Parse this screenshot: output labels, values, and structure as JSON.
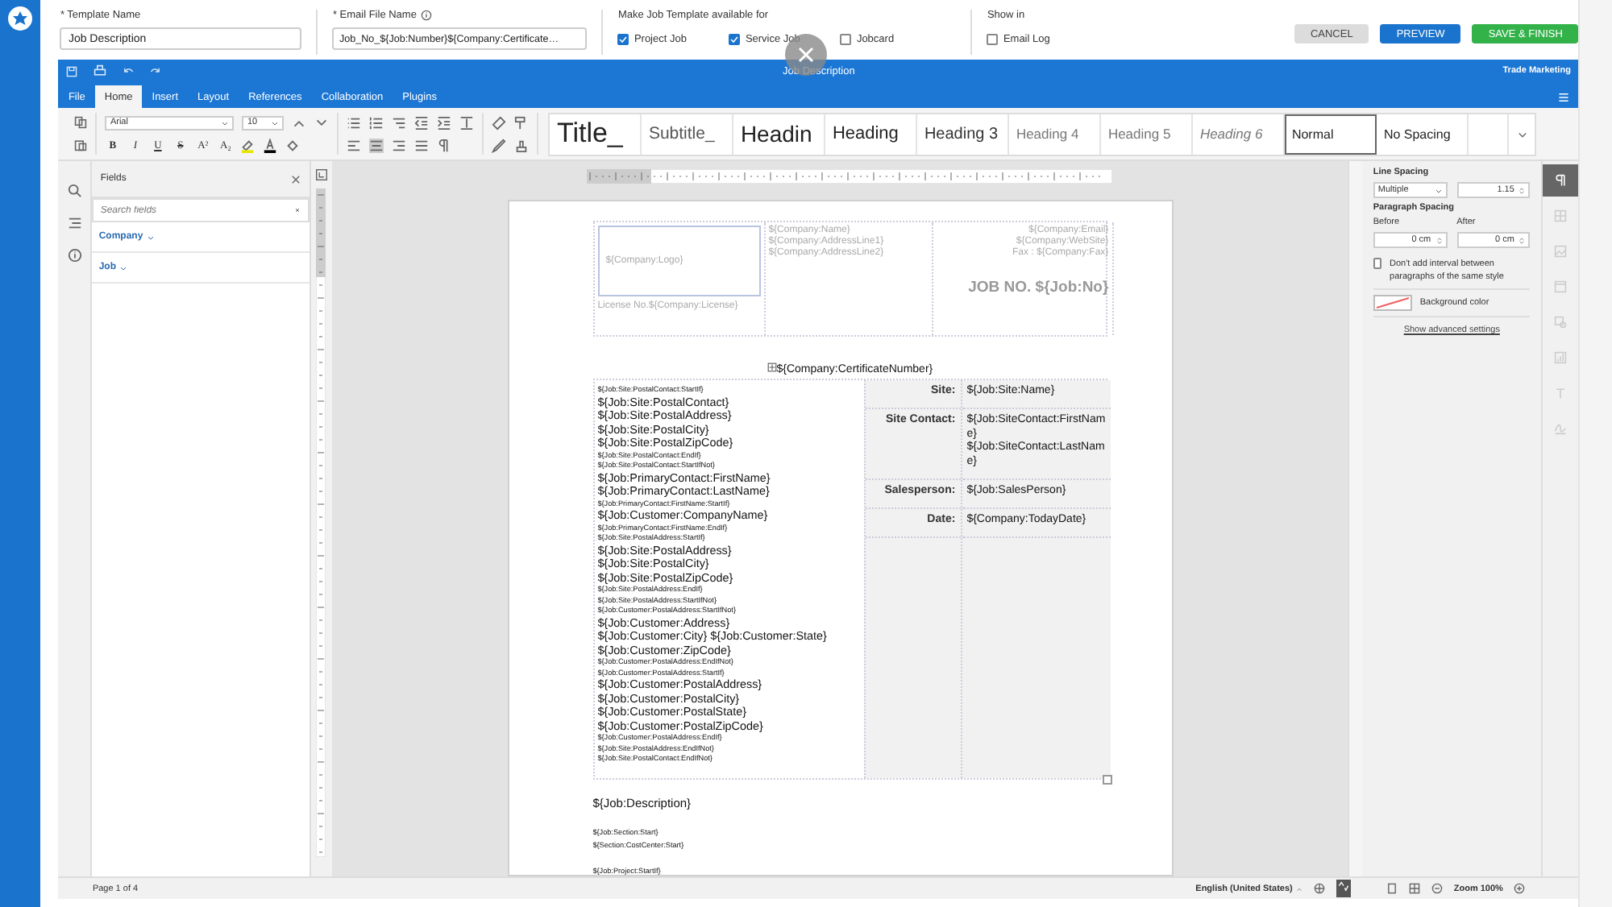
{
  "header": {
    "template_name": {
      "label": "* Template Name",
      "value": "Job Description"
    },
    "email_file_name": {
      "label": "* Email File Name",
      "value": "Job_No_${Job:Number}${Company:Certificate…"
    },
    "availability": {
      "label": "Make Job Template available for",
      "options": [
        {
          "label": "Project Job",
          "checked": true
        },
        {
          "label": "Service Job",
          "checked": true
        },
        {
          "label": "Jobcard",
          "checked": false
        }
      ]
    },
    "show_in": {
      "label": "Show in",
      "options": [
        {
          "label": "Email Log",
          "checked": false
        }
      ]
    },
    "buttons": [
      {
        "label": "CANCEL",
        "kind": "secondary"
      },
      {
        "label": "PREVIEW",
        "kind": "primary"
      },
      {
        "label": "SAVE & FINISH",
        "kind": "success"
      }
    ]
  },
  "editor": {
    "title": "Job Description",
    "account": "Trade Marketing",
    "tabs": [
      {
        "label": "File",
        "selected": false
      },
      {
        "label": "Home",
        "selected": true
      },
      {
        "label": "Insert",
        "selected": false
      },
      {
        "label": "Layout",
        "selected": false
      },
      {
        "label": "References",
        "selected": false
      },
      {
        "label": "Collaboration",
        "selected": false
      },
      {
        "label": "Plugins",
        "selected": false
      }
    ],
    "font": "Arial",
    "size": "10",
    "format_buttons": [
      {
        "label": "B",
        "kind": "bold"
      },
      {
        "label": "I",
        "kind": "italic"
      },
      {
        "label": "U",
        "kind": "underline"
      },
      {
        "label": "S",
        "kind": "strike"
      },
      {
        "label": "A²",
        "kind": "plain"
      },
      {
        "label": "A₂",
        "kind": "plain"
      }
    ],
    "styles": [
      {
        "label": "Title_",
        "kind": "title",
        "selected": false
      },
      {
        "label": "Subtitle_",
        "kind": "subtitle",
        "selected": false
      },
      {
        "label": "Headin",
        "kind": "heading1",
        "selected": false
      },
      {
        "label": "Heading",
        "kind": "heading2",
        "selected": false
      },
      {
        "label": "Heading 3",
        "kind": "heading3",
        "selected": false
      },
      {
        "label": "Heading 4",
        "kind": "heading4",
        "selected": false
      },
      {
        "label": "Heading 5",
        "kind": "heading5",
        "selected": false
      },
      {
        "label": "Heading 6",
        "kind": "heading6",
        "selected": false
      },
      {
        "label": "Normal",
        "kind": "normal",
        "selected": true
      },
      {
        "label": "No Spacing",
        "kind": "normal",
        "selected": false
      }
    ]
  },
  "fields_panel": {
    "title": "Fields",
    "search": {
      "placeholder": "Search fields"
    },
    "groups": [
      {
        "label": "Company"
      },
      {
        "label": "Job"
      }
    ]
  },
  "document": {
    "header": {
      "logo": "${Company:Logo}",
      "license": "License No.${Company:License}",
      "company_lines": [
        "${Company:Name}",
        "${Company:AddressLine1}",
        "${Company:AddressLine2}"
      ],
      "contact_lines": [
        "${Company:Email}",
        "${Company:WebSite}",
        "Fax : ${Company:Fax}"
      ],
      "job_no": "JOB NO. ${Job:No}"
    },
    "certificate": "${Company:CertificateNumber}",
    "address_lines": [
      {
        "text": "${Job:Site:PostalContact:StartIf}",
        "kind": "small"
      },
      {
        "text": "${Job:Site:PostalContact}",
        "kind": "large"
      },
      {
        "text": "${Job:Site:PostalAddress}",
        "kind": "large"
      },
      {
        "text": "${Job:Site:PostalCity}",
        "kind": "large"
      },
      {
        "text": "${Job:Site:PostalZipCode}",
        "kind": "large"
      },
      {
        "text": "${Job:Site:PostalContact:EndIf}",
        "kind": "small"
      },
      {
        "text": "${Job:Site:PostalContact:StartIfNot}",
        "kind": "small"
      },
      {
        "text": "${Job:PrimaryContact:FirstName}",
        "kind": "large"
      },
      {
        "text": "${Job:PrimaryContact:LastName}",
        "kind": "large"
      },
      {
        "text": "${Job:PrimaryContact:FirstName:StartIf}",
        "kind": "small"
      },
      {
        "text": "${Job:Customer:CompanyName}",
        "kind": "large"
      },
      {
        "text": "${Job:PrimaryContact:FirstName:EndIf}",
        "kind": "small"
      },
      {
        "text": "${Job:Site:PostalAddress:StartIf}",
        "kind": "small"
      },
      {
        "text": "${Job:Site:PostalAddress}",
        "kind": "large"
      },
      {
        "text": "${Job:Site:PostalCity}",
        "kind": "large"
      },
      {
        "text": "${Job:Site:PostalZipCode}",
        "kind": "large"
      },
      {
        "text": "${Job:Site:PostalAddress:EndIf}",
        "kind": "small"
      },
      {
        "text": "${Job:Site:PostalAddress:StartIfNot}",
        "kind": "small"
      },
      {
        "text": "${Job:Customer:PostalAddress:StartIfNot}",
        "kind": "small"
      },
      {
        "text": "${Job:Customer:Address}",
        "kind": "large"
      },
      {
        "text": "${Job:Customer:City} ${Job:Customer:State}",
        "kind": "large"
      },
      {
        "text": "${Job:Customer:ZipCode}",
        "kind": "large"
      },
      {
        "text": "${Job:Customer:PostalAddress:EndIfNot}",
        "kind": "small"
      },
      {
        "text": "${Job:Customer:PostalAddress:StartIf}",
        "kind": "small"
      },
      {
        "text": "${Job:Customer:PostalAddress}",
        "kind": "large"
      },
      {
        "text": "${Job:Customer:PostalCity}",
        "kind": "large"
      },
      {
        "text": "${Job:Customer:PostalState}",
        "kind": "large"
      },
      {
        "text": "${Job:Customer:PostalZipCode}",
        "kind": "large"
      },
      {
        "text": "${Job:Customer:PostalAddress:EndIf}",
        "kind": "small"
      },
      {
        "text": "${Job:Site:PostalAddress:EndIfNot}",
        "kind": "small"
      },
      {
        "text": "${Job:Site:PostalContact:EndIfNot}",
        "kind": "small"
      }
    ],
    "details": [
      {
        "label": "Site:",
        "values": [
          "${Job:Site:Name}"
        ]
      },
      {
        "label": "Site Contact:",
        "values": [
          "${Job:SiteContact:FirstName}",
          "${Job:SiteContact:LastName}"
        ]
      },
      {
        "label": "Salesperson:",
        "values": [
          "${Job:SalesPerson}"
        ]
      },
      {
        "label": "Date:",
        "values": [
          "${Company:TodayDate}"
        ]
      }
    ],
    "body_lines": [
      {
        "text": "${Job:Description}",
        "kind": "large"
      },
      {
        "text": "${Job:Section:Start}",
        "kind": "small"
      },
      {
        "text": "${Section:CostCenter:Start}",
        "kind": "small"
      },
      {
        "text": "${Job:Project:StartIf}",
        "kind": "spaced"
      }
    ]
  },
  "paragraph_panel": {
    "line_spacing": {
      "label": "Line Spacing",
      "mode": "Multiple",
      "value": "1.15"
    },
    "paragraph_spacing": {
      "label": "Paragraph Spacing",
      "before_label": "Before",
      "before": "0 cm",
      "after_label": "After",
      "after": "0 cm"
    },
    "no_interval": {
      "label": "Don't add interval between paragraphs of the same style",
      "checked": false
    },
    "background_label": "Background color",
    "advanced_link": "Show advanced settings"
  },
  "settings_tabs": [
    {
      "kind": "paragraph",
      "selected": true
    },
    {
      "kind": "table",
      "selected": false
    },
    {
      "kind": "image",
      "selected": false
    },
    {
      "kind": "header",
      "selected": false
    },
    {
      "kind": "shape",
      "selected": false
    },
    {
      "kind": "chart",
      "selected": false
    },
    {
      "kind": "text",
      "selected": false
    },
    {
      "kind": "signature",
      "selected": false
    }
  ],
  "status_bar": {
    "page": "Page 1 of 4",
    "language": "English (United States)",
    "zoom": "Zoom 100%"
  }
}
